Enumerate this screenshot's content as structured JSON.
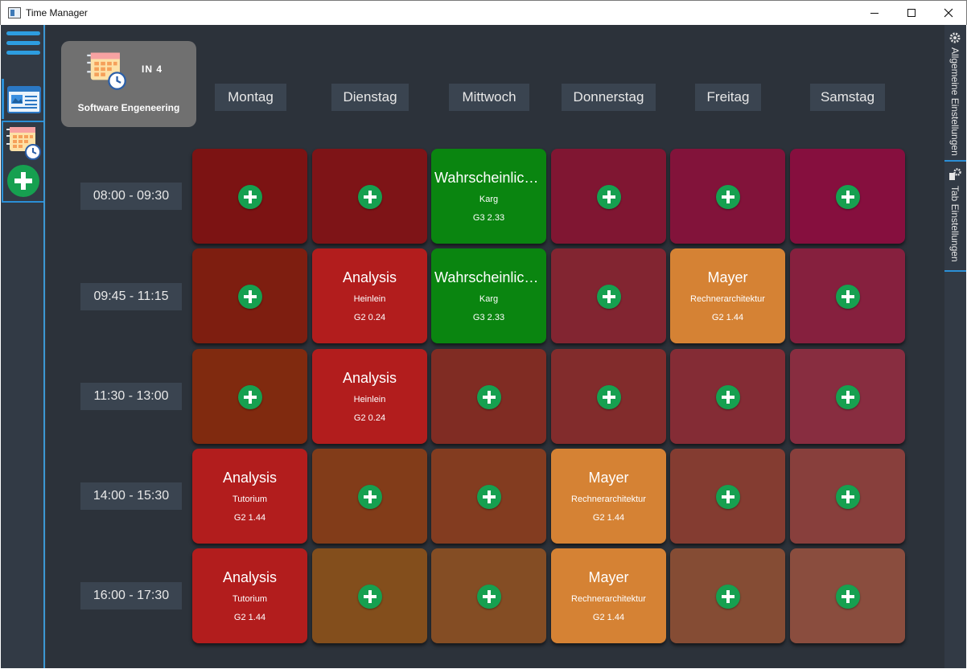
{
  "window": {
    "title": "Time Manager"
  },
  "course": {
    "code": "IN 4",
    "name": "Software Engeneering"
  },
  "right_tabs": [
    "Allgemeine Einstellungen",
    "Tab Einstellungen"
  ],
  "days": [
    "Montag",
    "Dienstag",
    "Mittwoch",
    "Donnerstag",
    "Freitag",
    "Samstag"
  ],
  "times": [
    "08:00 - 09:30",
    "09:45 - 11:15",
    "11:30 - 13:00",
    "14:00 - 15:30",
    "16:00 - 17:30"
  ],
  "colors": {
    "add_button": "#16a050",
    "accent": "#2b8fd6"
  },
  "grid": [
    [
      {
        "type": "empty",
        "color": "#7c1313"
      },
      {
        "type": "empty",
        "color": "#7e1417"
      },
      {
        "type": "lecture",
        "color": "#0a8510",
        "title": "Wahrscheinlich...",
        "teacher": "Karg",
        "room": "G3 2.33"
      },
      {
        "type": "empty",
        "color": "#801632"
      },
      {
        "type": "empty",
        "color": "#82133a"
      },
      {
        "type": "empty",
        "color": "#860f3e"
      }
    ],
    [
      {
        "type": "empty",
        "color": "#7e1e10"
      },
      {
        "type": "lecture",
        "color": "#b21d1d",
        "title": "Analysis",
        "teacher": "Heinlein",
        "room": "G2 0.24"
      },
      {
        "type": "lecture",
        "color": "#0a8510",
        "title": "Wahrscheinlich...",
        "teacher": "Karg",
        "room": "G3 2.33"
      },
      {
        "type": "empty",
        "color": "#822531"
      },
      {
        "type": "lecture",
        "color": "#d58234",
        "title": "Mayer",
        "teacher": "Rechnerarchitektur",
        "room": "G2 1.44"
      },
      {
        "type": "empty",
        "color": "#86203e"
      }
    ],
    [
      {
        "type": "empty",
        "color": "#802a0f"
      },
      {
        "type": "lecture",
        "color": "#b21d1d",
        "title": "Analysis",
        "teacher": "Heinlein",
        "room": "G2 0.24"
      },
      {
        "type": "empty",
        "color": "#802c23"
      },
      {
        "type": "empty",
        "color": "#822c2c"
      },
      {
        "type": "empty",
        "color": "#842c35"
      },
      {
        "type": "empty",
        "color": "#882d40"
      }
    ],
    [
      {
        "type": "lecture",
        "color": "#b21d1d",
        "title": "Analysis",
        "teacher": "Tutorium",
        "room": "G2 1.44"
      },
      {
        "type": "empty",
        "color": "#823c19"
      },
      {
        "type": "empty",
        "color": "#833c20"
      },
      {
        "type": "lecture",
        "color": "#d58234",
        "title": "Mayer",
        "teacher": "Rechnerarchitektur",
        "room": "G2 1.44"
      },
      {
        "type": "empty",
        "color": "#843c31"
      },
      {
        "type": "empty",
        "color": "#883f3c"
      }
    ],
    [
      {
        "type": "lecture",
        "color": "#b21d1d",
        "title": "Analysis",
        "teacher": "Tutorium",
        "room": "G2 1.44"
      },
      {
        "type": "empty",
        "color": "#834e1c"
      },
      {
        "type": "empty",
        "color": "#844d24"
      },
      {
        "type": "lecture",
        "color": "#d58234",
        "title": "Mayer",
        "teacher": "Rechnerarchitektur",
        "room": "G2 1.44"
      },
      {
        "type": "empty",
        "color": "#854c34"
      },
      {
        "type": "empty",
        "color": "#8a4d3e"
      }
    ]
  ]
}
